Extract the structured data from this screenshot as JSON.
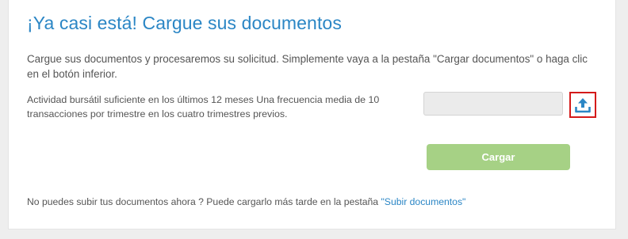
{
  "page": {
    "title": "¡Ya casi está! Cargue sus documentos",
    "intro": "Cargue sus documentos y procesaremos su solicitud. Simplemente vaya a la pestaña \"Cargar documentos\" o haga clic en el botón inferior.",
    "requirement": "Actividad bursátil suficiente en los últimos 12 meses Una frecuencia media de 10 transacciones por trimestre en los cuatro trimestres previos.",
    "file_input": {
      "value": "",
      "placeholder": ""
    },
    "upload_icon": "upload-icon",
    "submit_label": "Cargar",
    "footer_text": "No puedes subir tus documentos ahora ? Puede cargarlo más tarde en la pestaña ",
    "footer_link": "\"Subir documentos\""
  },
  "colors": {
    "title": "#2b86c5",
    "link": "#2b86c5",
    "submit_button": "#a6d185",
    "upload_highlight": "#d41a1a",
    "upload_icon": "#2b86c5",
    "background": "#eeeeee"
  }
}
